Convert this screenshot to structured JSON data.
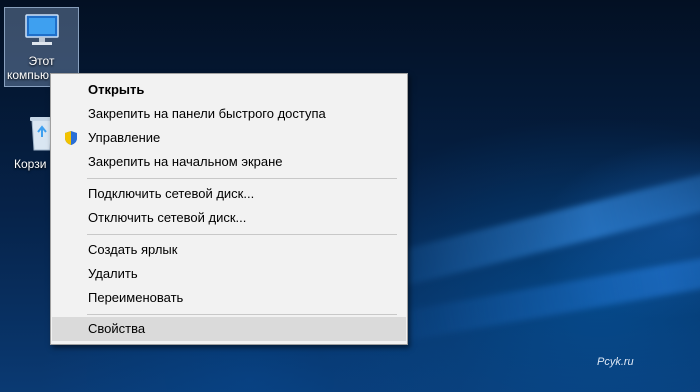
{
  "desktop": {
    "icons": [
      {
        "label_line1": "Этот",
        "label_line2": "компью"
      },
      {
        "label": "Корзи"
      }
    ],
    "watermark": "Pcyk.ru"
  },
  "context_menu": {
    "items": [
      {
        "label": "Открыть"
      },
      {
        "label": "Закрепить на панели быстрого доступа"
      },
      {
        "label": "Управление",
        "icon": "shield-icon"
      },
      {
        "label": "Закрепить на начальном экране"
      },
      {
        "label": "Подключить сетевой диск..."
      },
      {
        "label": "Отключить сетевой диск..."
      },
      {
        "label": "Создать ярлык"
      },
      {
        "label": "Удалить"
      },
      {
        "label": "Переименовать"
      },
      {
        "label": "Свойства"
      }
    ],
    "highlight_color": "#dadada",
    "background_color": "#f2f2f2"
  }
}
